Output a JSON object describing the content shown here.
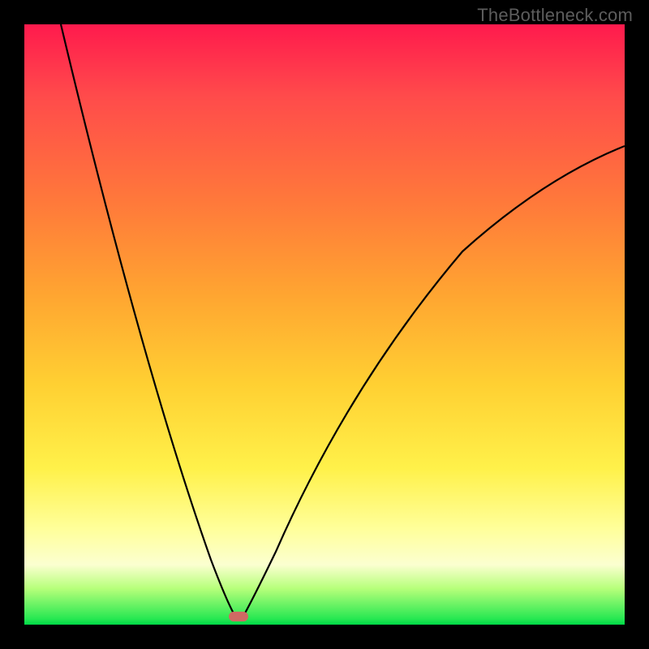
{
  "watermark": "TheBottleneck.com",
  "colors": {
    "frame_bg": "#000000",
    "grad_top": "#ff1a4d",
    "grad_mid": "#ffd032",
    "grad_bottom": "#00d847",
    "curve": "#000000",
    "marker": "#cf6a63",
    "watermark": "#5d5d5d"
  },
  "chart_data": {
    "type": "line",
    "title": "",
    "xlabel": "",
    "ylabel": "",
    "xlim": [
      0,
      100
    ],
    "ylim": [
      0,
      100
    ],
    "grid": false,
    "legend": false,
    "annotations": [
      "TheBottleneck.com"
    ],
    "series": [
      {
        "name": "bottleneck-curve",
        "x": [
          0,
          5,
          10,
          15,
          20,
          25,
          30,
          33,
          35,
          37,
          40,
          45,
          50,
          55,
          60,
          65,
          70,
          80,
          90,
          100
        ],
        "y": [
          100,
          86,
          72,
          58,
          44,
          30,
          15,
          4,
          0,
          3,
          11,
          25,
          35,
          44,
          51,
          57,
          62,
          70,
          76,
          80
        ]
      }
    ],
    "marker": {
      "x": 35,
      "y": 0
    }
  }
}
